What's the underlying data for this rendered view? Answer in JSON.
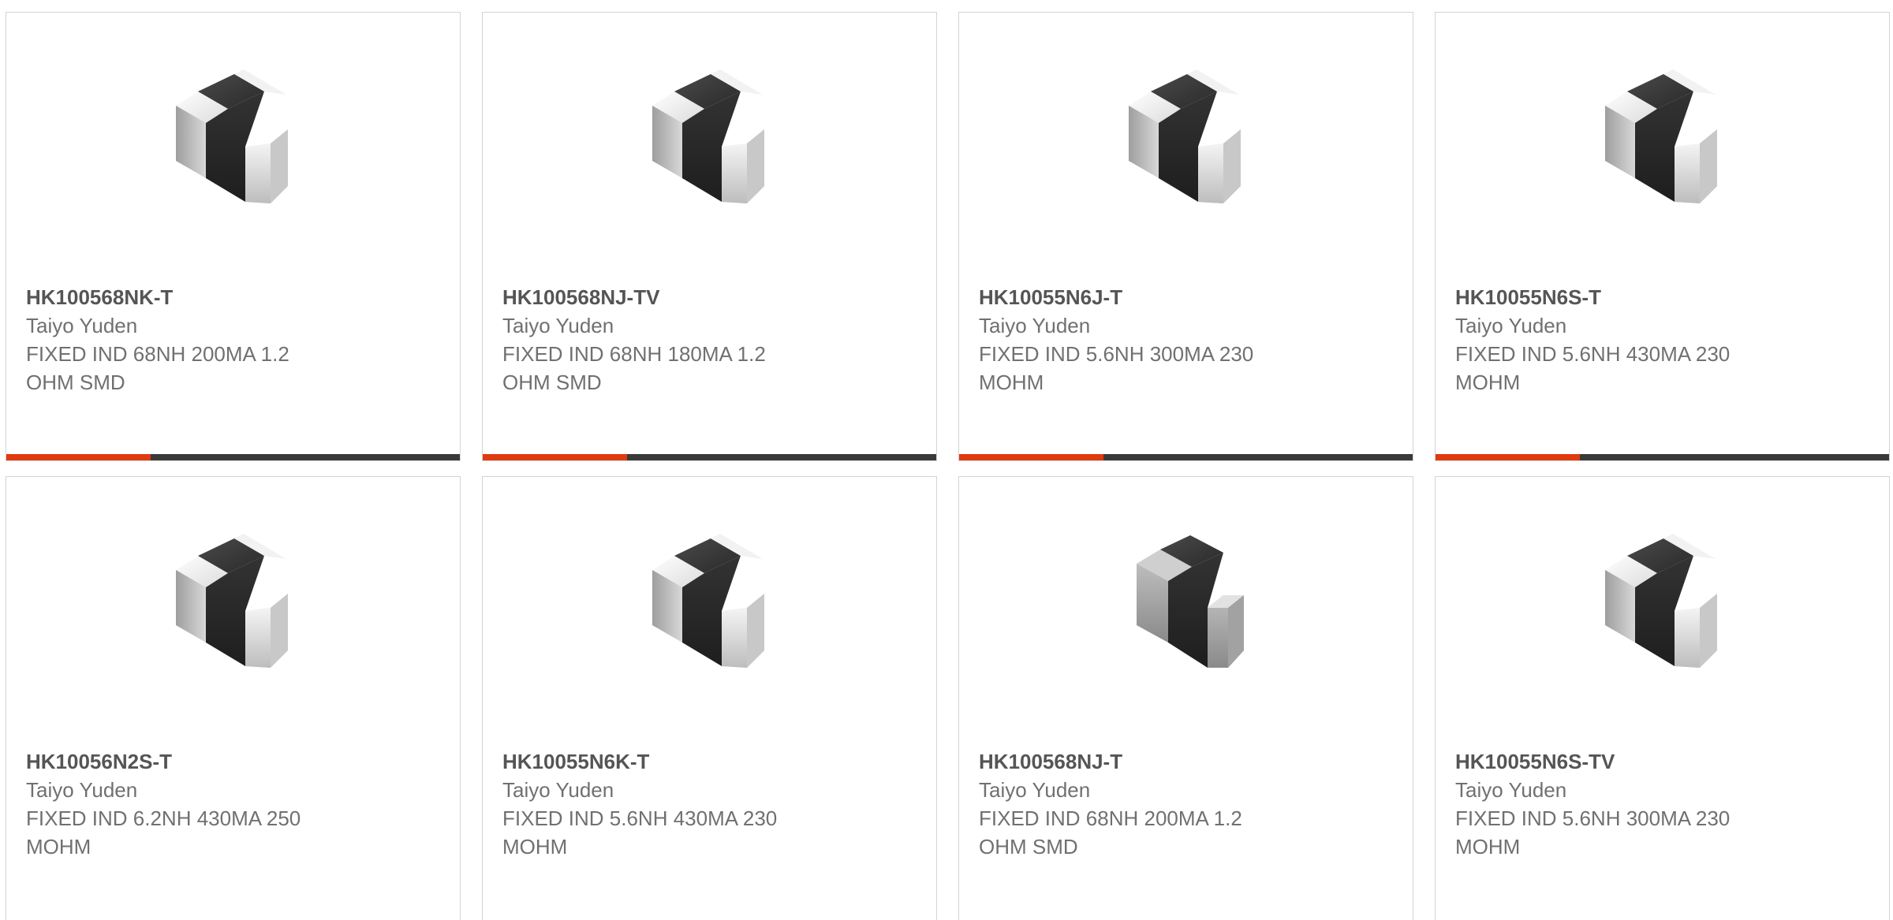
{
  "colors": {
    "accent": "#e03a0f",
    "bar": "#3a3a3a",
    "border": "#d4d4d4",
    "part_text": "#555555",
    "body_text": "#707070"
  },
  "products": [
    {
      "part": "HK100568NK-T",
      "manufacturer": "Taiyo Yuden",
      "description": "FIXED IND 68NH 200MA 1.2 OHM SMD",
      "image": "chip-inductor-image"
    },
    {
      "part": "HK100568NJ-TV",
      "manufacturer": "Taiyo Yuden",
      "description": "FIXED IND 68NH 180MA 1.2 OHM SMD",
      "image": "chip-inductor-image"
    },
    {
      "part": "HK10055N6J-T",
      "manufacturer": "Taiyo Yuden",
      "description": "FIXED IND 5.6NH 300MA 230 MOHM",
      "image": "chip-inductor-image"
    },
    {
      "part": "HK10055N6S-T",
      "manufacturer": "Taiyo Yuden",
      "description": "FIXED IND 5.6NH 430MA 230 MOHM",
      "image": "chip-inductor-image"
    },
    {
      "part": "HK10056N2S-T",
      "manufacturer": "Taiyo Yuden",
      "description": "FIXED IND 6.2NH 430MA 250 MOHM",
      "image": "chip-inductor-image"
    },
    {
      "part": "HK10055N6K-T",
      "manufacturer": "Taiyo Yuden",
      "description": "FIXED IND 5.6NH 430MA 230 MOHM",
      "image": "chip-inductor-image"
    },
    {
      "part": "HK100568NJ-T",
      "manufacturer": "Taiyo Yuden",
      "description": "FIXED IND 68NH 200MA 1.2 OHM SMD",
      "image": "chip-inductor-gray-image"
    },
    {
      "part": "HK10055N6S-TV",
      "manufacturer": "Taiyo Yuden",
      "description": "FIXED IND 5.6NH 300MA 230 MOHM",
      "image": "chip-inductor-image"
    }
  ]
}
